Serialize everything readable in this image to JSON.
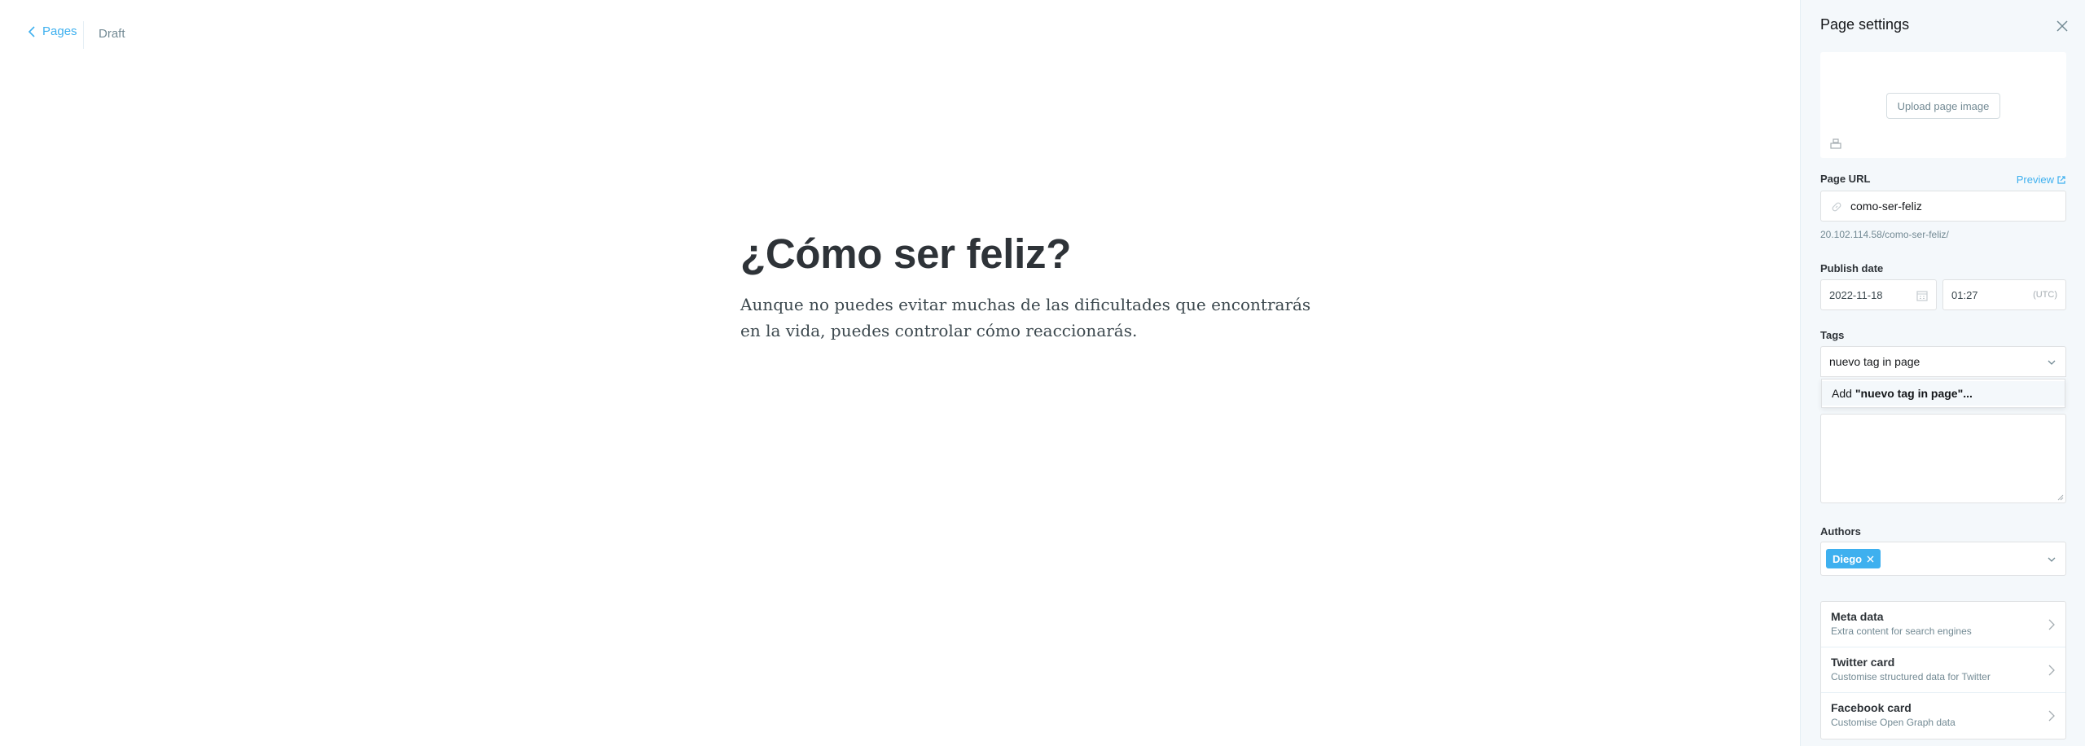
{
  "topbar": {
    "back_label": "Pages",
    "status": "Draft"
  },
  "editor": {
    "title": "¿Cómo ser feliz?",
    "body": "Aunque no puedes evitar muchas de las dificultades que encontrarás en la vida, puedes controlar cómo reaccionarás."
  },
  "settings": {
    "title": "Page settings",
    "upload_label": "Upload page image",
    "url_label": "Page URL",
    "preview_label": "Preview",
    "url_value": "como-ser-feliz",
    "url_hint": "20.102.114.58/como-ser-feliz/",
    "publish_label": "Publish date",
    "date_value": "2022-11-18",
    "time_value": "01:27",
    "timezone": "(UTC)",
    "tags_label": "Tags",
    "tags_input_value": "nuevo tag in page",
    "dropdown_prefix": "Add",
    "dropdown_tag": "\"nuevo tag in page\"...",
    "authors_label": "Authors",
    "author": "Diego",
    "nav": [
      {
        "title": "Meta data",
        "desc": "Extra content for search engines"
      },
      {
        "title": "Twitter card",
        "desc": "Customise structured data for Twitter"
      },
      {
        "title": "Facebook card",
        "desc": "Customise Open Graph data"
      }
    ]
  },
  "colors": {
    "accent": "#3eb0ef",
    "panel_bg": "#f4f8fb",
    "muted": "#738a94"
  }
}
